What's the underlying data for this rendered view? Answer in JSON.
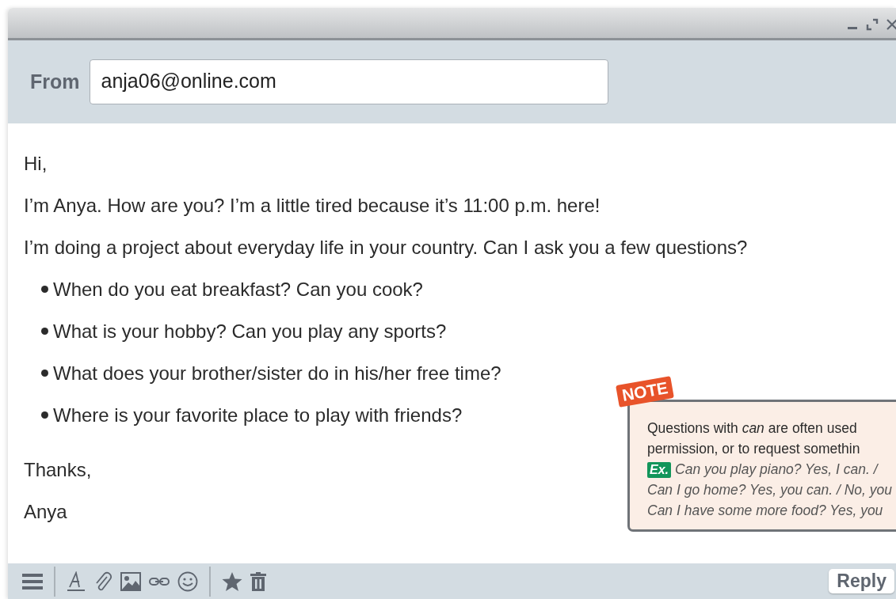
{
  "header": {
    "from_label": "From",
    "from_value": "anja06@online.com"
  },
  "message": {
    "greeting": "Hi,",
    "paragraphs": [
      "I’m Anya. How are you? I’m a little tired because it’s 11:00 p.m. here!",
      "I’m doing a project about everyday life in your country. Can I ask you a few questions?"
    ],
    "questions": [
      "When do you eat breakfast? Can you cook?",
      "What is your hobby? Can you play any sports?",
      "What does your brother/sister do in his/her free time?",
      "Where is your favorite place to play with friends?"
    ],
    "closing": "Thanks,",
    "signature": "Anya"
  },
  "note": {
    "tag": "NOTE",
    "lines": [
      "Questions with *can* are often used",
      "permission, or to request somethin"
    ],
    "example_label": "Ex.",
    "examples": [
      "Can you play piano? Yes, I can. /",
      "Can I go home? Yes, you can. / No, you",
      "Can I have some more food? Yes, you"
    ]
  },
  "toolbar": {
    "reply_button": "Reply"
  }
}
